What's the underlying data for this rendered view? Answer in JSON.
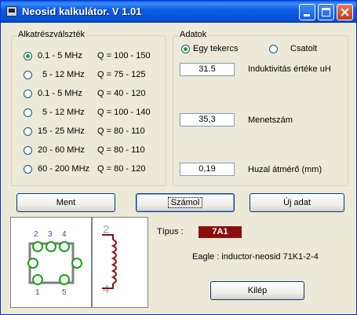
{
  "window": {
    "title": "Neosid kalkulátor.  V 1.01"
  },
  "parts_group": {
    "label": "Alkatrészválszték",
    "options": [
      {
        "range": "0.1  -   5 MHz",
        "q": "Q = 100 - 150",
        "selected": true
      },
      {
        "range": "5  -  12  MHz",
        "q": "Q =  75 - 125",
        "selected": false
      },
      {
        "range": "0.1  -   5 MHz",
        "q": "Q =   40 - 120",
        "selected": false
      },
      {
        "range": "5  -  12  MHz",
        "q": "Q = 100 - 140",
        "selected": false
      },
      {
        "range": "15  -  25 MHz",
        "q": "Q =   80 - 110",
        "selected": false
      },
      {
        "range": "20  -  60 MHz",
        "q": "Q =   80 - 110",
        "selected": false
      },
      {
        "range": "60 - 200 MHz",
        "q": "Q =   80 - 120",
        "selected": false
      }
    ]
  },
  "data_group": {
    "label": "Adatok",
    "mode_single": "Egy tekercs",
    "mode_coupled": "Csatolt",
    "inductance_value": "31.5",
    "inductance_label": "Induktivitás értéke uH",
    "turns_value": "35,3",
    "turns_label": "Menetszám",
    "wire_value": "0,19",
    "wire_label": "Huzal átmérő (mm)"
  },
  "buttons": {
    "save": "Ment",
    "calculate": "Számol",
    "new_data": "Új adat",
    "exit": "Kilép"
  },
  "result": {
    "type_label": "Típus :",
    "type_value": "7A1",
    "eagle_text": "Eagle : inductor-neosid 71K1-2-4"
  },
  "diagram": {
    "pins_top": [
      "2",
      "3",
      "4"
    ],
    "pins_bottom": [
      "1",
      "5"
    ],
    "coil_top": "2",
    "coil_bottom": "4"
  },
  "colors": {
    "pad_green": "#16a316",
    "pin_label_purple": "#7030a0",
    "coil_red": "#8b0e0e",
    "type_badge": "#8b0e0e"
  }
}
